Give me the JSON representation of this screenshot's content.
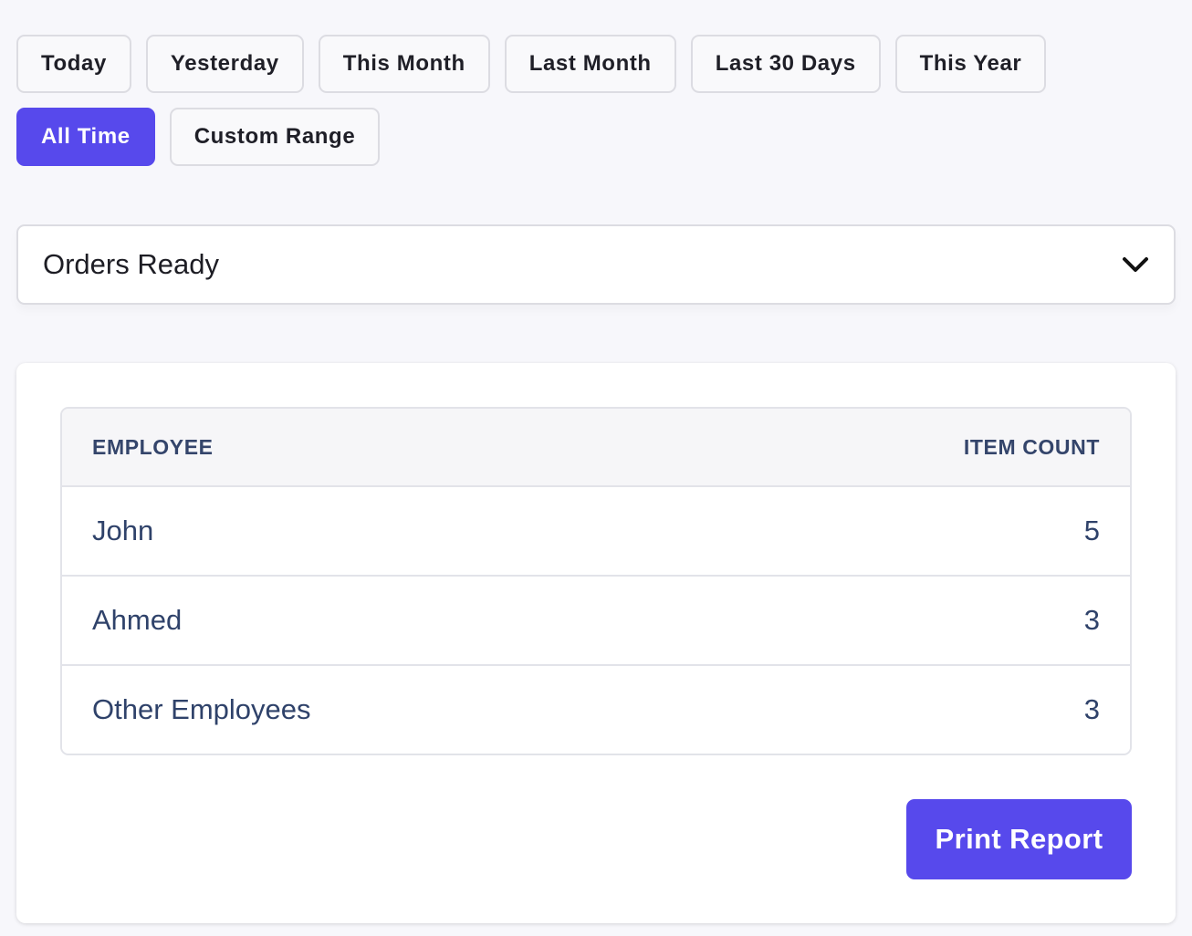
{
  "date_ranges": [
    {
      "label": "Today",
      "active": false
    },
    {
      "label": "Yesterday",
      "active": false
    },
    {
      "label": "This Month",
      "active": false
    },
    {
      "label": "Last Month",
      "active": false
    },
    {
      "label": "Last 30 Days",
      "active": false
    },
    {
      "label": "This Year",
      "active": false
    },
    {
      "label": "All Time",
      "active": true
    },
    {
      "label": "Custom Range",
      "active": false
    }
  ],
  "report_select": {
    "selected": "Orders Ready",
    "icon": "chevron-down-icon"
  },
  "table": {
    "headers": {
      "employee": "EMPLOYEE",
      "item_count": "ITEM COUNT"
    },
    "rows": [
      {
        "employee": "John",
        "item_count": "5"
      },
      {
        "employee": "Ahmed",
        "item_count": "3"
      },
      {
        "employee": "Other Employees",
        "item_count": "3"
      }
    ]
  },
  "actions": {
    "print_label": "Print Report"
  },
  "colors": {
    "accent": "#5749ec",
    "background": "#f7f7fb",
    "header_text": "#34456b",
    "row_text": "#2f426a"
  }
}
